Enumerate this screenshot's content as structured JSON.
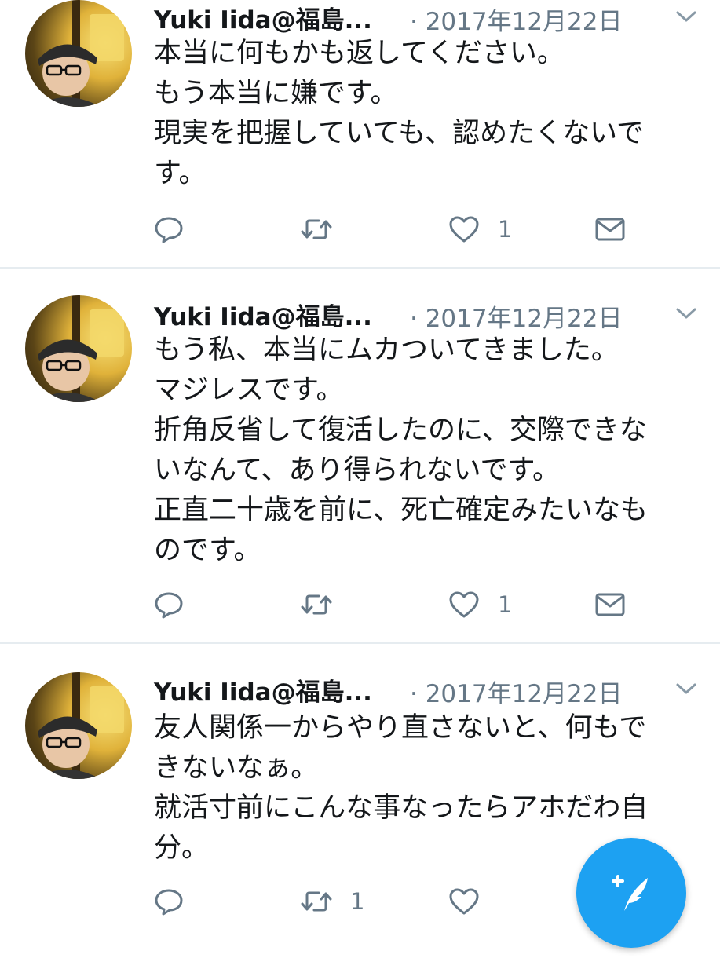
{
  "tweets": [
    {
      "author": "Yuki Iida@福島...",
      "date": "· 2017年12月22日",
      "lines": [
        "本当に何もかも返してください。",
        "もう本当に嫌です。",
        "現実を把握していても、認めたくないで",
        "す。"
      ],
      "reply_count": "",
      "retweet_count": "",
      "like_count": "1",
      "show_dm": true
    },
    {
      "author": "Yuki Iida@福島...",
      "date": "· 2017年12月22日",
      "lines": [
        "もう私、本当にムカついてきました。",
        "マジレスです。",
        "折角反省して復活したのに、交際できな",
        "いなんて、あり得られないです。",
        "正直二十歳を前に、死亡確定みたいなも",
        "のです。"
      ],
      "reply_count": "",
      "retweet_count": "",
      "like_count": "1",
      "show_dm": true
    },
    {
      "author": "Yuki Iida@福島...",
      "date": "· 2017年12月22日",
      "lines": [
        "友人関係一からやり直さないと、何もで",
        "きないなぁ。",
        "就活寸前にこんな事なったらアホだわ自",
        "分。"
      ],
      "reply_count": "",
      "retweet_count": "1",
      "like_count": "",
      "show_dm": false
    }
  ],
  "icons": {
    "reply": "reply-icon",
    "retweet": "retweet-icon",
    "like": "heart-icon",
    "dm": "envelope-icon",
    "menu": "chevron-down-icon",
    "compose": "compose-tweet-icon"
  },
  "colors": {
    "accent": "#1da1f2",
    "secondary_text": "#657786",
    "primary_text": "#14171a",
    "divider": "#e6ecf0"
  }
}
